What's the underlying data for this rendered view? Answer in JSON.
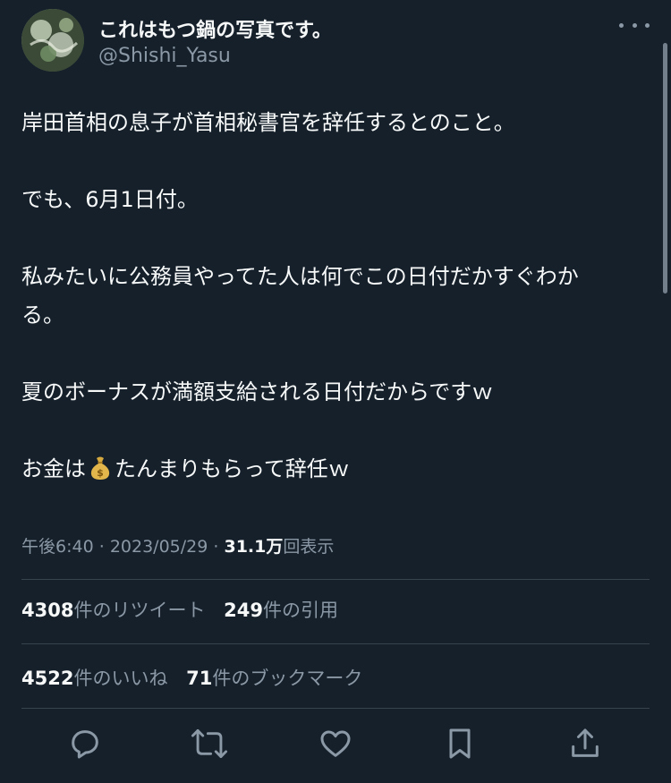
{
  "user": {
    "display_name": "これはもつ鍋の写真です。",
    "handle": "@Shishi_Yasu",
    "avatar_icon": "avatar-photo"
  },
  "tweet": {
    "line1": "岸田首相の息子が首相秘書官を辞任するとのこと。",
    "line2": "でも、6月1日付。",
    "line3": "私みたいに公務員やってた人は何でこの日付だかすぐわか",
    "line3b": "る。",
    "line4": "夏のボーナスが満額支給される日付だからですｗ",
    "line5_pre": "お金は",
    "line5_emoji": "money-bag-icon",
    "line5_post": "たんまりもらって辞任ｗ"
  },
  "meta": {
    "time": "午後6:40",
    "sep1": "·",
    "date": "2023/05/29",
    "sep2": "·",
    "views_count": "31.1万",
    "views_label": "回表示"
  },
  "stats": {
    "retweets_count": "4308",
    "retweets_label": "件のリツイート",
    "quotes_count": "249",
    "quotes_label": "件の引用",
    "likes_count": "4522",
    "likes_label": "件のいいね",
    "bookmarks_count": "71",
    "bookmarks_label": "件のブックマーク"
  },
  "actions": [
    "reply-icon",
    "retweet-icon",
    "like-icon",
    "bookmark-icon",
    "share-icon"
  ],
  "colors": {
    "background": "#15202b",
    "text": "#f7f9f9",
    "secondary": "#8b98a5",
    "divider": "#38444d"
  }
}
